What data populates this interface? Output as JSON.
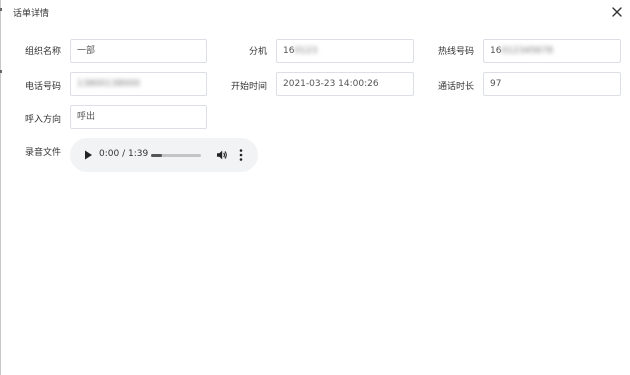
{
  "dialog": {
    "title": "话单详情"
  },
  "fields": {
    "org_name": {
      "label": "组织名称",
      "value": "一部"
    },
    "extension": {
      "label": "分机",
      "value_visible": "16",
      "value_obscured": "0123"
    },
    "hotline": {
      "label": "热线号码",
      "value_visible": "16",
      "value_obscured": "012345678"
    },
    "phone": {
      "label": "电话号码",
      "value_visible": "",
      "value_obscured": "13800138000"
    },
    "start_time": {
      "label": "开始时间",
      "value": "2021-03-23 14:00:26"
    },
    "duration": {
      "label": "通话时长",
      "value": "97"
    },
    "direction": {
      "label": "呼入方向",
      "value": "呼出"
    },
    "recording": {
      "label": "录音文件"
    }
  },
  "audio": {
    "time_display": "0:00 / 1:39",
    "progress": 0.22
  },
  "icons": {
    "close": "close-icon",
    "play": "play-icon",
    "volume": "volume-icon",
    "more": "more-vertical-icon"
  }
}
